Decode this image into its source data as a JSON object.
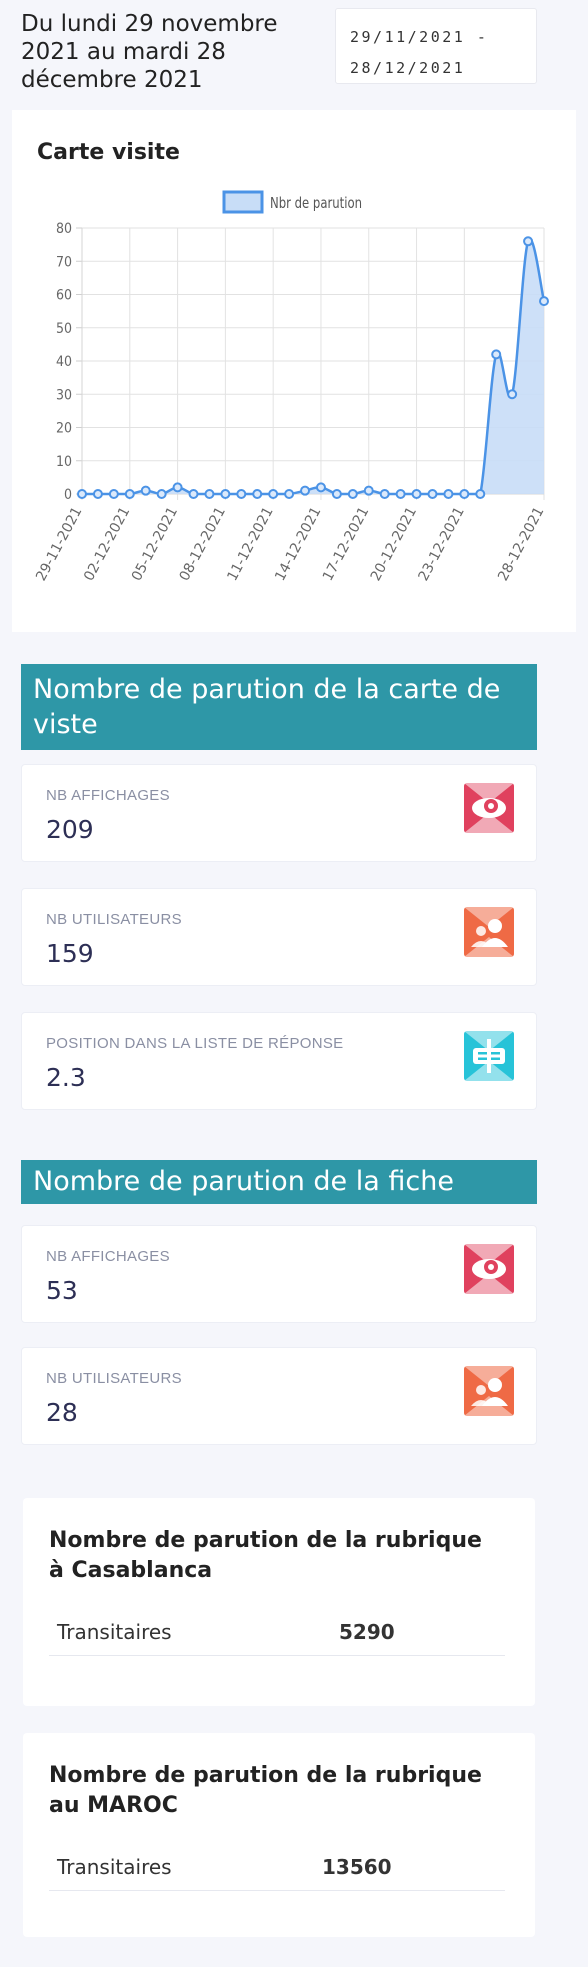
{
  "period": {
    "text": "Du lundi 29 novembre 2021 au mardi 28 décembre 2021",
    "input_start": "29/11/2021 -",
    "input_end": "28/12/2021"
  },
  "chart_card": {
    "title": "Carte visite"
  },
  "chart_data": {
    "type": "area",
    "title": "Carte visite",
    "legend": [
      "Nbr de parution"
    ],
    "legend_position": "top",
    "grid": true,
    "ylim": [
      0,
      80
    ],
    "yticks": [
      0,
      10,
      20,
      30,
      40,
      50,
      60,
      70,
      80
    ],
    "x": [
      "29-11-2021",
      "30-11-2021",
      "01-12-2021",
      "02-12-2021",
      "03-12-2021",
      "04-12-2021",
      "05-12-2021",
      "06-12-2021",
      "07-12-2021",
      "08-12-2021",
      "09-12-2021",
      "10-12-2021",
      "11-12-2021",
      "12-12-2021",
      "13-12-2021",
      "14-12-2021",
      "15-12-2021",
      "16-12-2021",
      "17-12-2021",
      "18-12-2021",
      "19-12-2021",
      "20-12-2021",
      "21-12-2021",
      "22-12-2021",
      "23-12-2021",
      "24-12-2021",
      "25-12-2021",
      "26-12-2021",
      "27-12-2021",
      "28-12-2021"
    ],
    "xticks": [
      "29-11-2021",
      "02-12-2021",
      "05-12-2021",
      "08-12-2021",
      "11-12-2021",
      "14-12-2021",
      "17-12-2021",
      "20-12-2021",
      "23-12-2021",
      "28-12-2021"
    ],
    "series": [
      {
        "name": "Nbr de parution",
        "values": [
          0,
          0,
          0,
          0,
          1,
          0,
          2,
          0,
          0,
          0,
          0,
          0,
          0,
          0,
          1,
          2,
          0,
          0,
          1,
          0,
          0,
          0,
          0,
          0,
          0,
          0,
          42,
          30,
          76,
          58
        ]
      }
    ],
    "colors": {
      "line": "#4b93e6",
      "fill": "#c8ddf7",
      "point": "#4b93e6"
    }
  },
  "section_carte": {
    "title": "Nombre de parution de la carte de viste",
    "stats": [
      {
        "label": "NB AFFICHAGES",
        "value": "209",
        "icon": "eye-icon"
      },
      {
        "label": "NB UTILISATEURS",
        "value": "159",
        "icon": "users-icon"
      },
      {
        "label": "POSITION DANS LA LISTE DE RÉPONSE",
        "value": "2.3",
        "icon": "list-position-icon"
      }
    ]
  },
  "section_fiche": {
    "title": "Nombre de parution de la fiche",
    "stats": [
      {
        "label": "NB AFFICHAGES",
        "value": "53",
        "icon": "eye-icon"
      },
      {
        "label": "NB UTILISATEURS",
        "value": "28",
        "icon": "users-icon"
      }
    ]
  },
  "rubriques": [
    {
      "title": "Nombre de parution de la rubrique à Casablanca",
      "row_label": "Transitaires",
      "row_value": "5290"
    },
    {
      "title": "Nombre de parution de la rubrique au MAROC",
      "row_label": "Transitaires",
      "row_value": "13560"
    }
  ],
  "colors": {
    "section_header": "#2e97a7",
    "icon_eye": "#e0415e",
    "icon_users": "#ef6a45",
    "icon_list": "#27c3d8"
  }
}
